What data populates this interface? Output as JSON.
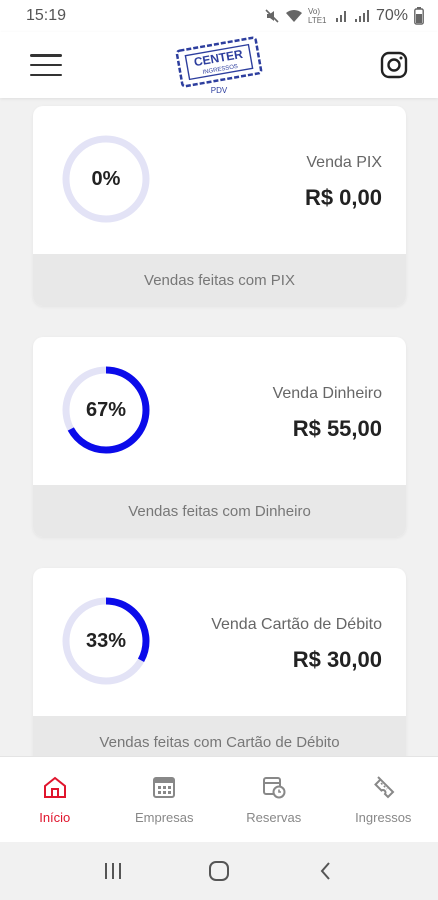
{
  "status_bar": {
    "time": "15:19",
    "network_label": "Vo) LTE1",
    "battery": "70%"
  },
  "header": {
    "logo_text_main": "CENTER",
    "logo_text_sub": "INGRESSOS",
    "logo_text_pdv": "PDV",
    "menu_icon": "hamburger-icon",
    "instagram_icon": "instagram-icon"
  },
  "cards": [
    {
      "percent": 0,
      "percent_label": "0%",
      "title": "Venda PIX",
      "value": "R$ 0,00",
      "footer": "Vendas feitas com PIX"
    },
    {
      "percent": 67,
      "percent_label": "67%",
      "title": "Venda Dinheiro",
      "value": "R$ 55,00",
      "footer": "Vendas feitas com Dinheiro"
    },
    {
      "percent": 33,
      "percent_label": "33%",
      "title": "Venda Cartão de Débito",
      "value": "R$ 30,00",
      "footer": "Vendas feitas com Cartão de Débito"
    }
  ],
  "bottom_nav": {
    "items": [
      {
        "label": "Início",
        "icon": "home-icon",
        "active": true
      },
      {
        "label": "Empresas",
        "icon": "building-icon",
        "active": false
      },
      {
        "label": "Reservas",
        "icon": "calendar-clock-icon",
        "active": false
      },
      {
        "label": "Ingressos",
        "icon": "ticket-icon",
        "active": false
      }
    ]
  },
  "colors": {
    "accent": "#e0152d",
    "ring_progress": "#0b0bea",
    "ring_track": "#e3e3f6"
  }
}
